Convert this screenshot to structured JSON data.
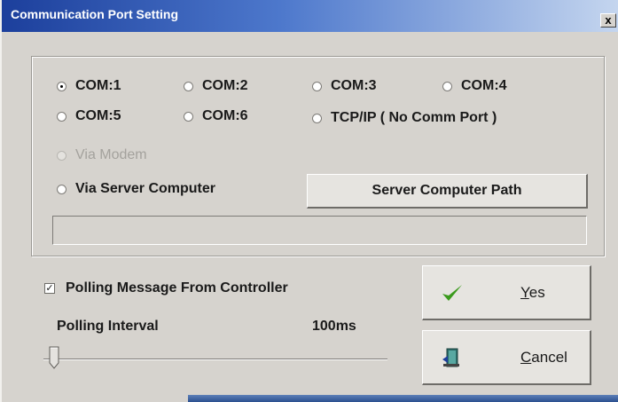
{
  "window": {
    "title": "Communication Port Setting",
    "close_label": "x"
  },
  "ports": [
    {
      "label": "COM:1",
      "checked": true
    },
    {
      "label": "COM:2",
      "checked": false
    },
    {
      "label": "COM:3",
      "checked": false
    },
    {
      "label": "COM:4",
      "checked": false
    },
    {
      "label": "COM:5",
      "checked": false
    },
    {
      "label": "COM:6",
      "checked": false
    },
    {
      "label": "TCP/IP ( No Comm Port )",
      "checked": false
    }
  ],
  "via_modem": {
    "label": "Via Modem",
    "enabled": false
  },
  "via_server": {
    "label": "Via Server Computer"
  },
  "server_path_button": {
    "label": "Server Computer Path"
  },
  "server_path_field": {
    "value": ""
  },
  "polling": {
    "checkbox_label": "Polling Message From Controller",
    "checked": true,
    "interval_label": "Polling Interval",
    "interval_value": "100ms"
  },
  "buttons": {
    "yes_label": "Yes",
    "yes_mnemonic": "Y",
    "yes_rest": "es",
    "cancel_label": "Cancel",
    "cancel_mnemonic": "C",
    "cancel_rest": "ancel"
  },
  "colors": {
    "titlebar_start": "#1c3f9c",
    "face": "#d6d3ce",
    "yes_check": "#3a9a1c"
  }
}
